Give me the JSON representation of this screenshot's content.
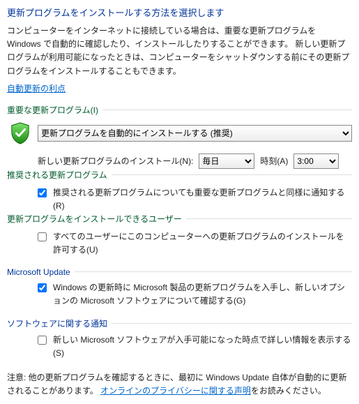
{
  "header": {
    "title": "更新プログラムをインストールする方法を選択します",
    "description": "コンピューターをインターネットに接続している場合は、重要な更新プログラムを Windows で自動的に確認したり、インストールしたりすることができます。 新しい更新プログラムが利用可能になったときは、コンピューターをシャットダウンする前にその更新プログラムをインストールすることもできます。",
    "benefits_link": "自動更新の利点"
  },
  "important": {
    "section_label": "重要な更新プログラム(I)",
    "main_select_value": "更新プログラムを自動的にインストールする (推奨)",
    "schedule_label": "新しい更新プログラムのインストール(N):",
    "freq_value": "毎日",
    "time_label": "時刻(A)",
    "time_value": "3:00"
  },
  "recommended": {
    "section_label": "推奨される更新プログラム",
    "checkbox_label": "推奨される更新プログラムについても重要な更新プログラムと同様に通知する(R)",
    "checked": true
  },
  "who": {
    "section_label": "更新プログラムをインストールできるユーザー",
    "checkbox_label": "すべてのユーザーにこのコンピューターへの更新プログラムのインストールを許可する(U)",
    "checked": false
  },
  "msupdate": {
    "section_label": "Microsoft Update",
    "checkbox_label": "Windows の更新時に Microsoft 製品の更新プログラムを入手し、新しいオプションの Microsoft ソフトウェアについて確認する(G)",
    "checked": true
  },
  "software_notif": {
    "section_label": "ソフトウェアに関する通知",
    "checkbox_label": "新しい Microsoft ソフトウェアが入手可能になった時点で詳しい情報を表示する(S)",
    "checked": false
  },
  "footer": {
    "note_prefix": "注意: 他の更新プログラムを確認するときに、最初に Windows Update 自体が自動的に更新されることがあります。",
    "privacy_link": "オンラインのプライバシーに関する声明",
    "note_suffix": "をお読みください。"
  }
}
